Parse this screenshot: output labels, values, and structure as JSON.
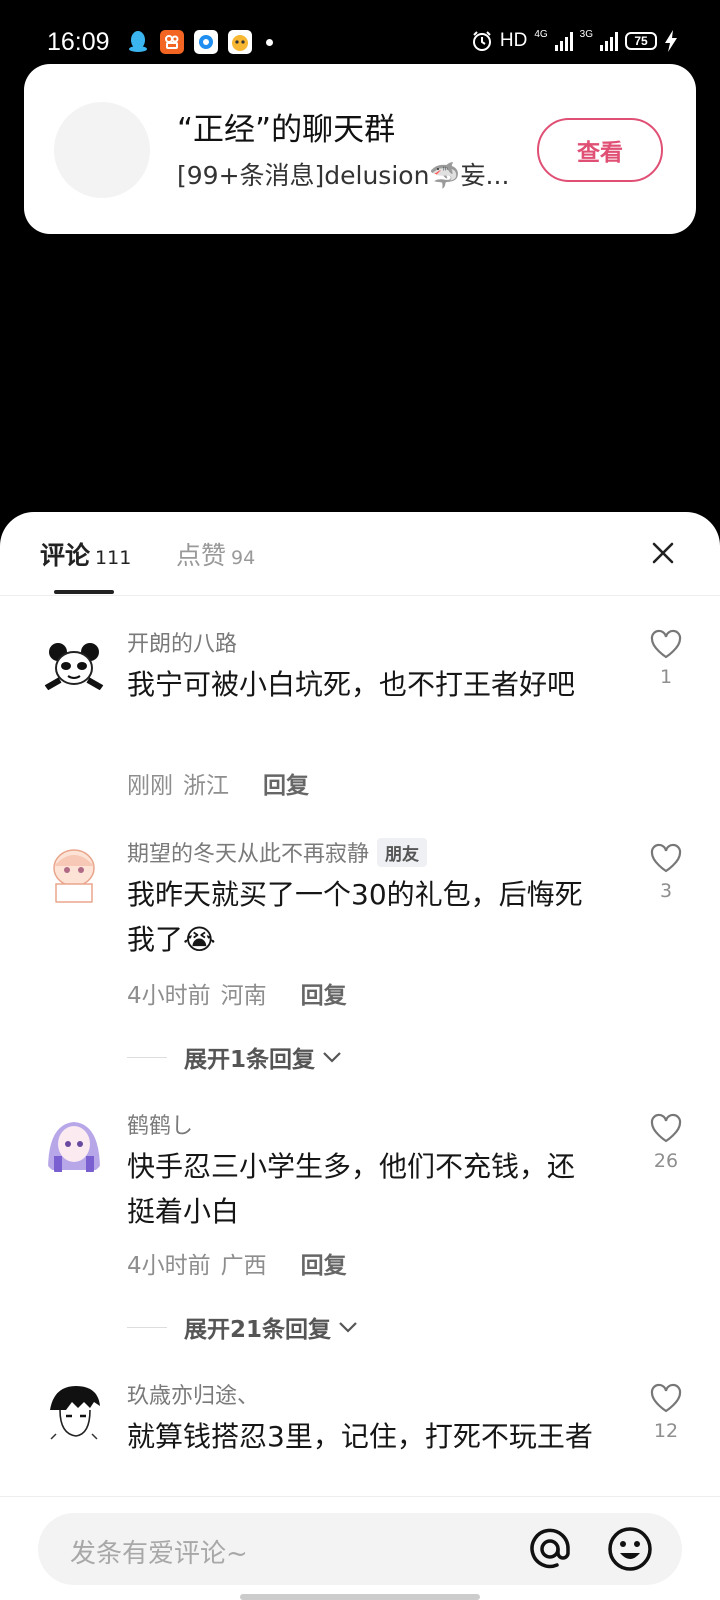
{
  "status_bar": {
    "time": "16:09",
    "hd_label": "HD",
    "net1": "4G",
    "net2": "3G",
    "battery": "75"
  },
  "notification": {
    "title": "“正经”的聊天群",
    "message": "[99+条消息]delusion🦈妄...",
    "button": "查看"
  },
  "tabs": {
    "comments_label": "评论",
    "comments_count": "111",
    "likes_label": "点赞",
    "likes_count": "94"
  },
  "comments": [
    {
      "user": "开朗的八路",
      "text": "我宁可被小白坑死，也不打王者好吧",
      "time": "刚刚",
      "location": "浙江",
      "reply": "回复",
      "likes": "1"
    },
    {
      "user": "期望的冬天从此不再寂静",
      "badge": "朋友",
      "text": "我昨天就买了一个30的礼包，后悔死我了😭",
      "time": "4小时前",
      "location": "河南",
      "reply": "回复",
      "likes": "3",
      "expand": "展开1条回复"
    },
    {
      "user": "鹤鹤し",
      "text": "快手忍三小学生多，他们不充钱，还挺着小白",
      "time": "4小时前",
      "location": "广西",
      "reply": "回复",
      "likes": "26",
      "expand": "展开21条回复"
    },
    {
      "user": "玖歳亦归途、",
      "text": "就算钱搭忍3里，记住，打死不玩王者",
      "likes": "12"
    }
  ],
  "input": {
    "placeholder": "发条有爱评论~"
  }
}
